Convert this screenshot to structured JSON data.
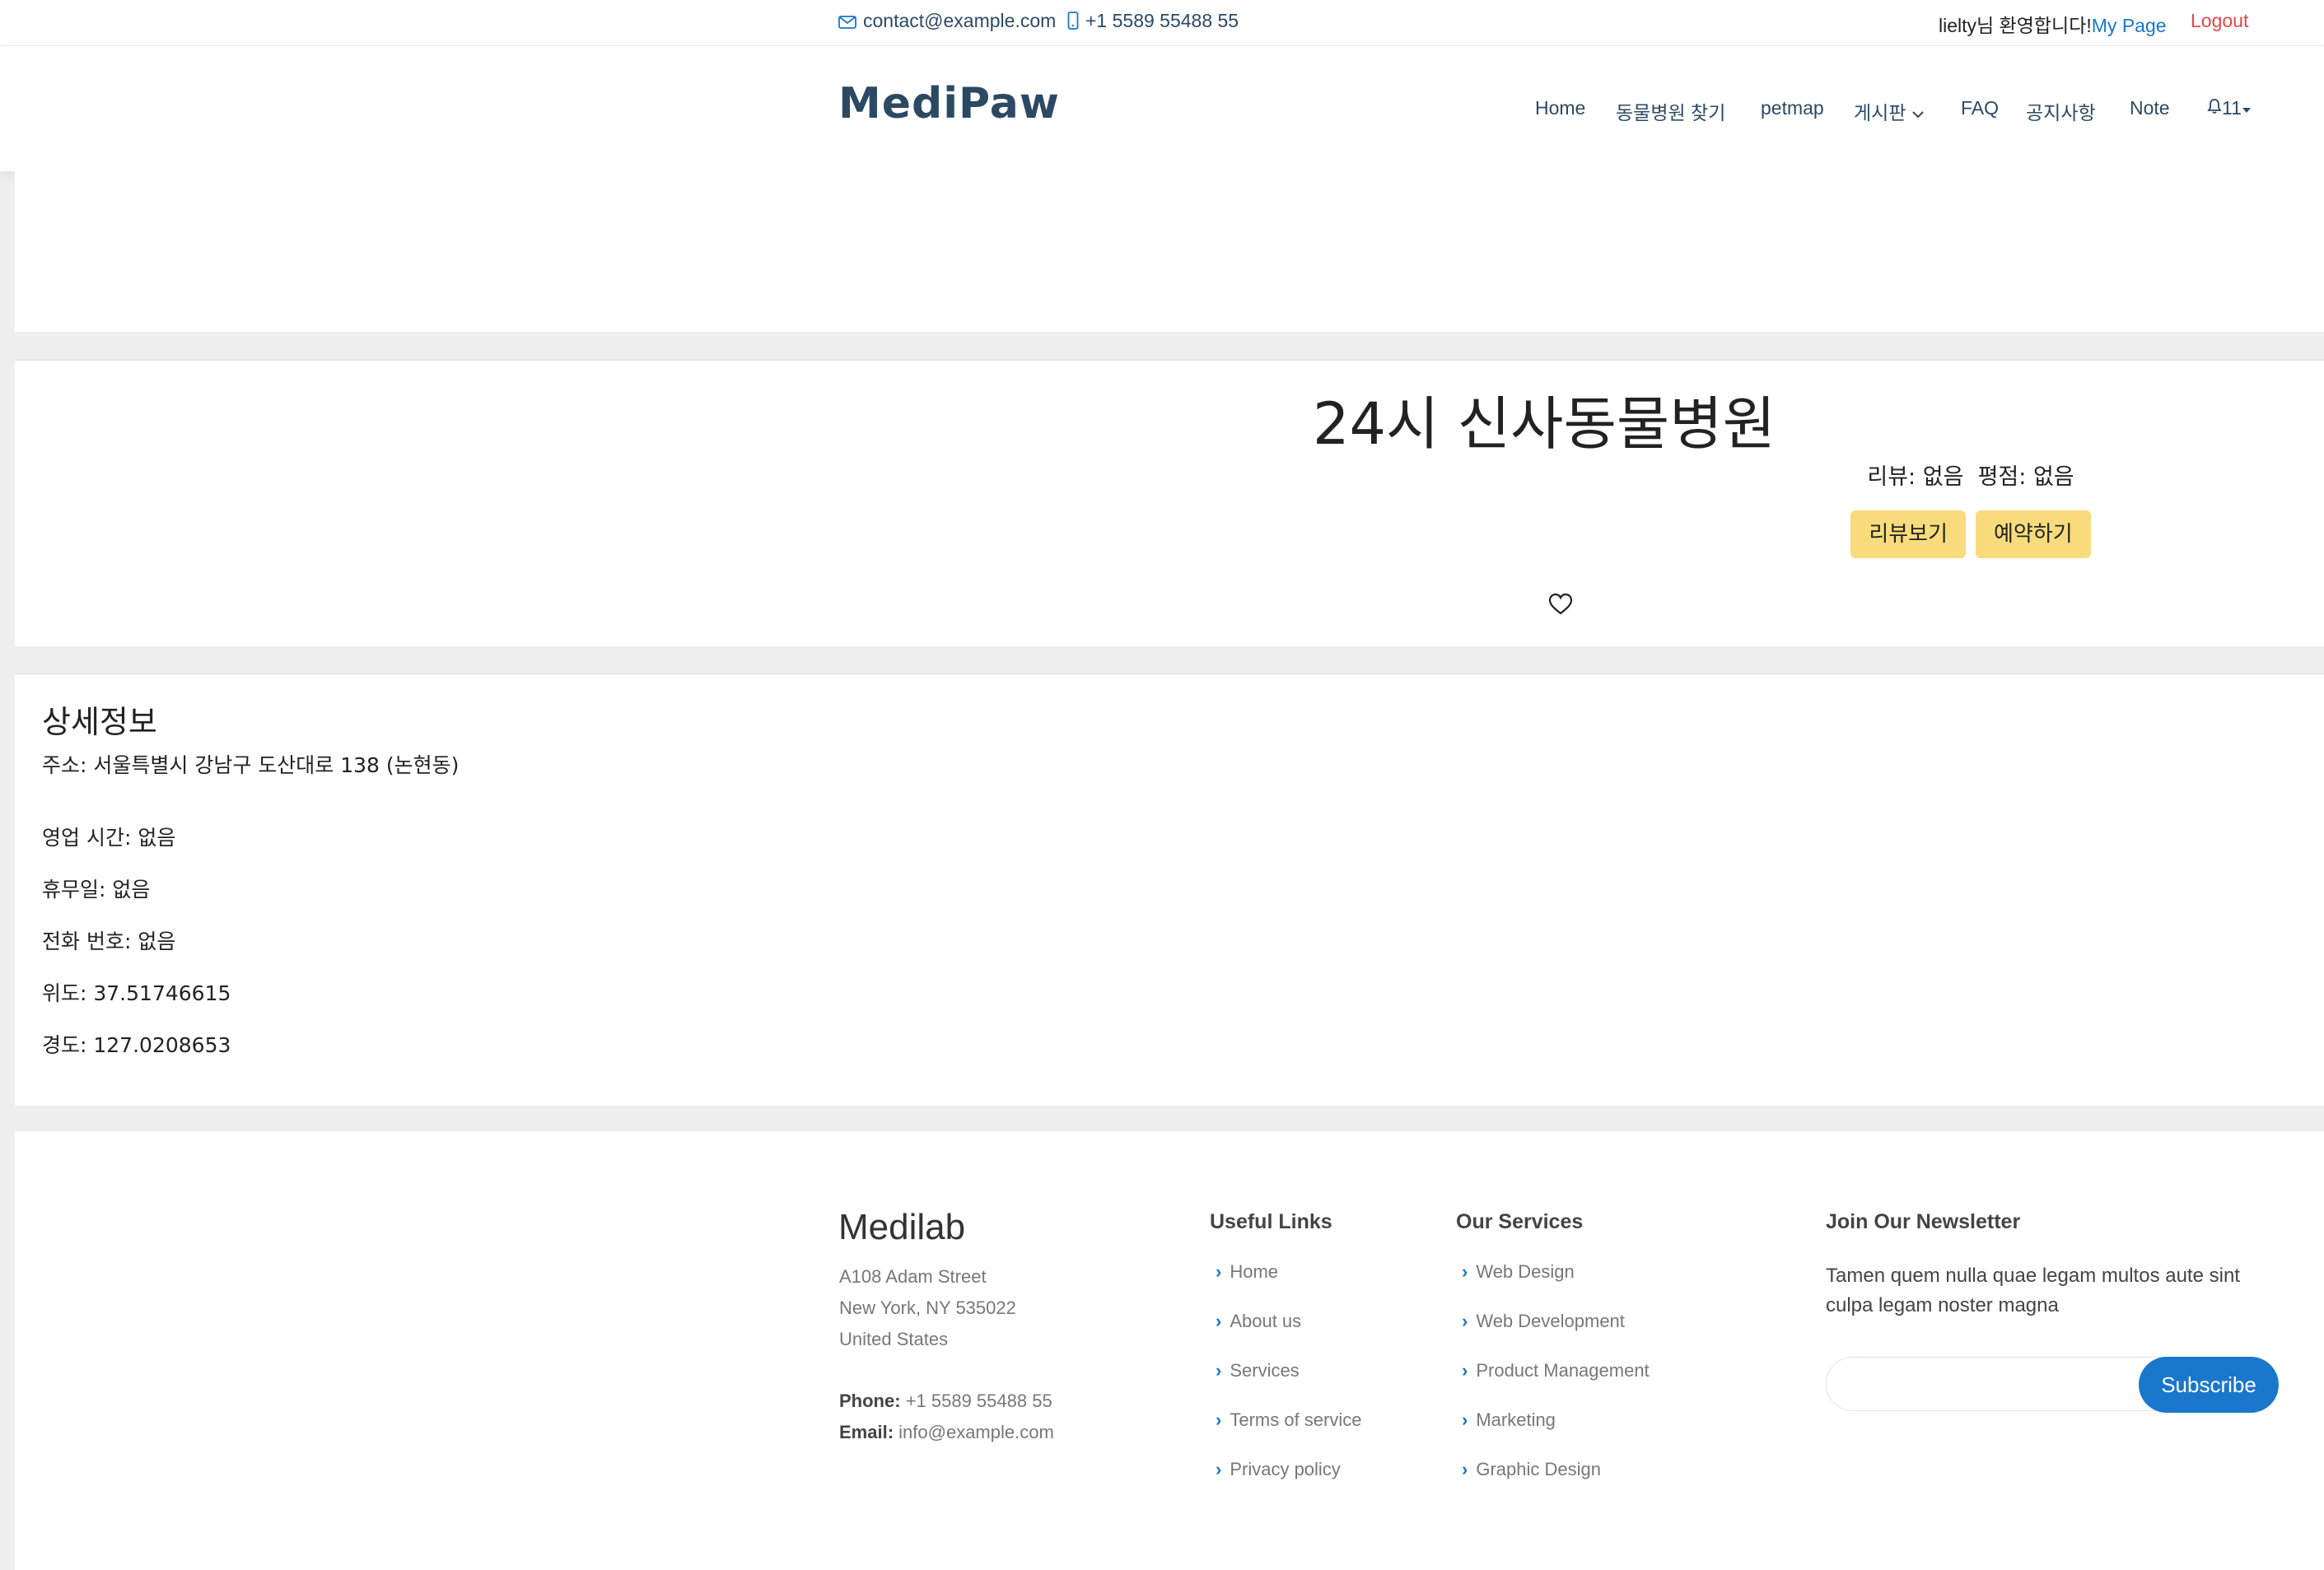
{
  "topbar": {
    "email": "contact@example.com",
    "phone": "+1 5589 55488 55",
    "welcome": "lielty님 환영합니다!",
    "mypage": "My Page",
    "logout": "Logout"
  },
  "header": {
    "logo": "MediPaw",
    "nav": {
      "home": "Home",
      "find": "동물병원 찾기",
      "petmap": "petmap",
      "board": "게시판",
      "faq": "FAQ",
      "notice": "공지사항",
      "note": "Note",
      "alerts": "11"
    }
  },
  "hospital": {
    "name": "24시 신사동물병원",
    "review_line": "리뷰: 없음  평점: 없음",
    "review_button": "리뷰보기",
    "reserve_button": "예약하기"
  },
  "detail": {
    "title": "상세정보",
    "address": "주소: 서울특별시 강남구 도산대로 138 (논현동)",
    "hours": "영업 시간: 없음",
    "holiday": "휴무일: 없음",
    "phone": "전화 번호: 없음",
    "latitude": "위도: 37.51746615",
    "longitude": "경도: 127.0208653"
  },
  "footer": {
    "brand": "Medilab",
    "address": [
      "A108 Adam Street",
      "New York, NY 535022",
      "United States"
    ],
    "phone_label": "Phone:",
    "phone": "+1 5589 55488 55",
    "email_label": "Email:",
    "email": "info@example.com",
    "useful_links": {
      "title": "Useful Links",
      "items": [
        "Home",
        "About us",
        "Services",
        "Terms of service",
        "Privacy policy"
      ]
    },
    "services": {
      "title": "Our Services",
      "items": [
        "Web Design",
        "Web Development",
        "Product Management",
        "Marketing",
        "Graphic Design"
      ]
    },
    "newsletter": {
      "title": "Join Our Newsletter",
      "text": "Tamen quem nulla quae legam multos aute sint culpa legam noster magna",
      "button": "Subscribe"
    }
  },
  "colors": {
    "accent": "#1977cc",
    "navy": "#2c4964",
    "button_yellow": "#f8dc7c",
    "logout": "#e04848"
  }
}
